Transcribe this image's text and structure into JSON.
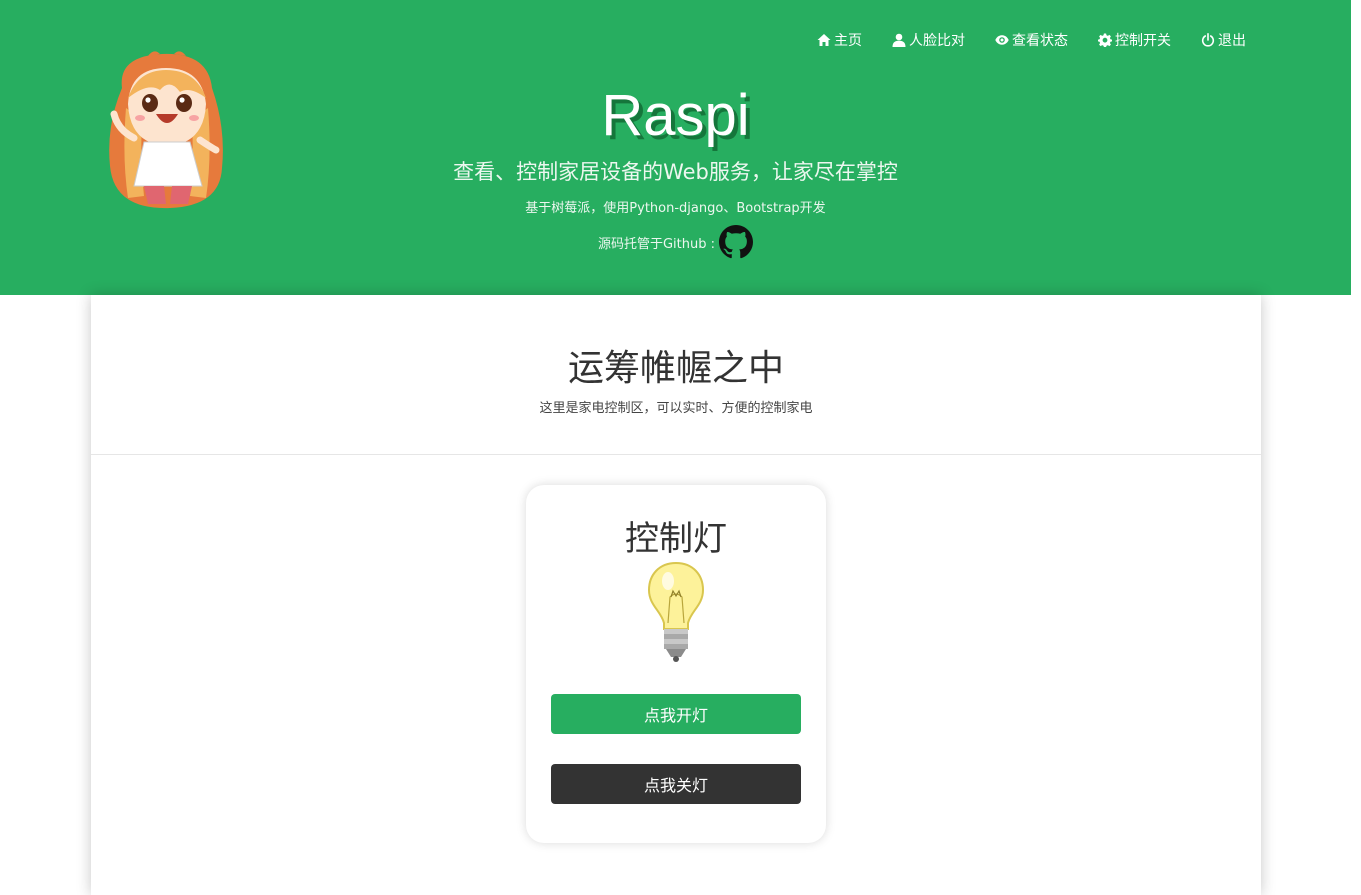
{
  "nav": {
    "items": [
      {
        "label": "主页",
        "icon": "home-icon"
      },
      {
        "label": "人脸比对",
        "icon": "user-icon"
      },
      {
        "label": "查看状态",
        "icon": "eye-icon"
      },
      {
        "label": "控制开关",
        "icon": "gear-icon"
      },
      {
        "label": "退出",
        "icon": "power-icon"
      }
    ]
  },
  "hero": {
    "brand": "Raspi",
    "tagline": "查看、控制家居设备的Web服务，让家尽在掌控",
    "built_on": "基于树莓派，使用Python-django、Bootstrap开发",
    "repo_label": "源码托管于Github :"
  },
  "section": {
    "title": "运筹帷幄之中",
    "subtitle": "这里是家电控制区，可以实时、方便的控制家电"
  },
  "light_card": {
    "title": "控制灯",
    "on_button": "点我开灯",
    "off_button": "点我关灯"
  },
  "colors": {
    "brand_green": "#27ae60",
    "dark_button": "#333333"
  }
}
